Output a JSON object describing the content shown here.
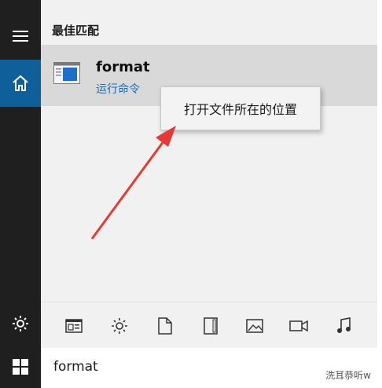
{
  "section": {
    "title": "最佳匹配"
  },
  "best_match": {
    "title": "format",
    "subtitle": "运行命令"
  },
  "context_menu": {
    "items": [
      "打开文件所在的位置"
    ]
  },
  "search": {
    "query": "format"
  },
  "filters": {
    "icons": [
      "apps-icon",
      "settings-icon",
      "document-icon",
      "folder-icon",
      "photo-icon",
      "video-icon",
      "music-icon"
    ]
  },
  "watermark": {
    "text": "洗耳恭听w"
  },
  "colors": {
    "rail": "#1f1f1f",
    "rail_active": "#0f5f9a",
    "accent_link": "#1a6db3",
    "arrow": "#e53935"
  }
}
